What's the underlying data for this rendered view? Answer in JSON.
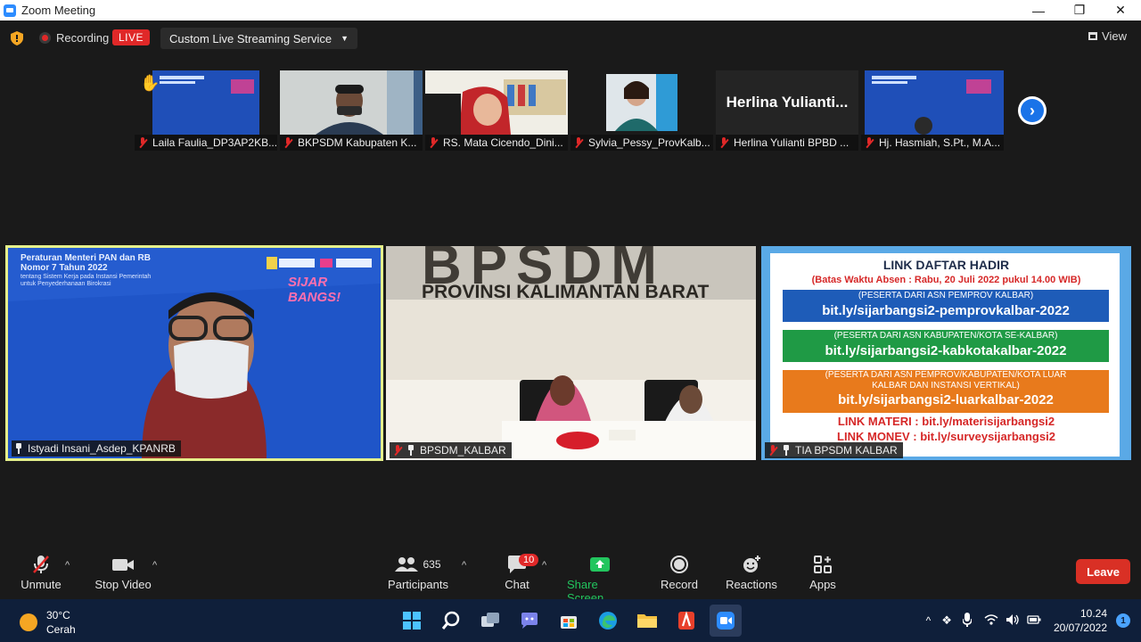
{
  "window": {
    "title": "Zoom Meeting"
  },
  "topbar": {
    "recording_label": "Recording",
    "live_label": "LIVE",
    "stream_label": "Custom Live Streaming Service",
    "view_label": "View"
  },
  "gallery": [
    {
      "name": "Laila Faulia_DP3AP2KB...",
      "hand_raised": true
    },
    {
      "name": "BKPSDM Kabupaten K..."
    },
    {
      "name": "RS. Mata Cicendo_Dini..."
    },
    {
      "name": "Sylvia_Pessy_ProvKalb..."
    },
    {
      "name": "Herlina Yulianti BPBD ...",
      "display_text": "Herlina Yulianti..."
    },
    {
      "name": "Hj. Hasmiah, S.Pt., M.A..."
    }
  ],
  "tiles": {
    "speaker": {
      "name": "Istyadi Insani_Asdep_KPANRB",
      "slide_title_1": "Peraturan Menteri PAN dan RB",
      "slide_title_2": "Nomor 7 Tahun 2022",
      "slide_sub_1": "tentang Sistem Kerja pada Instansi Pemerintah",
      "slide_sub_2": "untuk Penyederhanaan Birokrasi",
      "logo_text": "SIJAR BANGS!"
    },
    "room": {
      "name": "BPSDM_KALBAR",
      "wall_top": "BPSDM",
      "wall_text": "PROVINSI KALIMANTAN BARAT"
    },
    "links": {
      "name": "TIA BPSDM KALBAR",
      "heading": "LINK DAFTAR HADIR",
      "deadline": "(Batas Waktu Absen : Rabu, 20 Juli 2022 pukul 14.00 WIB)",
      "blue_small": "(PESERTA DARI ASN PEMPROV KALBAR)",
      "blue_link": "bit.ly/sijarbangsi2-pemprovkalbar-2022",
      "green_small": "(PESERTA DARI ASN KABUPATEN/KOTA SE-KALBAR)",
      "green_link": "bit.ly/sijarbangsi2-kabkotakalbar-2022",
      "orange_small_1": "(PESERTA DARI ASN PEMPROV/KABUPATEN/KOTA LUAR",
      "orange_small_2": "KALBAR DAN INSTANSI VERTIKAL)",
      "orange_link": "bit.ly/sijarbangsi2-luarkalbar-2022",
      "materi": "LINK MATERI : bit.ly/materisijarbangsi2",
      "money": "LINK MONEV : bit.ly/surveysijarbangsi2"
    }
  },
  "toolbar": {
    "unmute": "Unmute",
    "stop_video": "Stop Video",
    "participants": "Participants",
    "participants_count": "635",
    "chat": "Chat",
    "chat_badge": "10",
    "share": "Share Screen",
    "record": "Record",
    "reactions": "Reactions",
    "apps": "Apps",
    "leave": "Leave"
  },
  "taskbar": {
    "temp": "30°C",
    "weather": "Cerah",
    "time": "10.24",
    "date": "20/07/2022",
    "notifications": "1"
  },
  "colors": {
    "accent": "#2d8cff",
    "live": "#e02828",
    "share": "#22c55e",
    "leave": "#d93025"
  }
}
